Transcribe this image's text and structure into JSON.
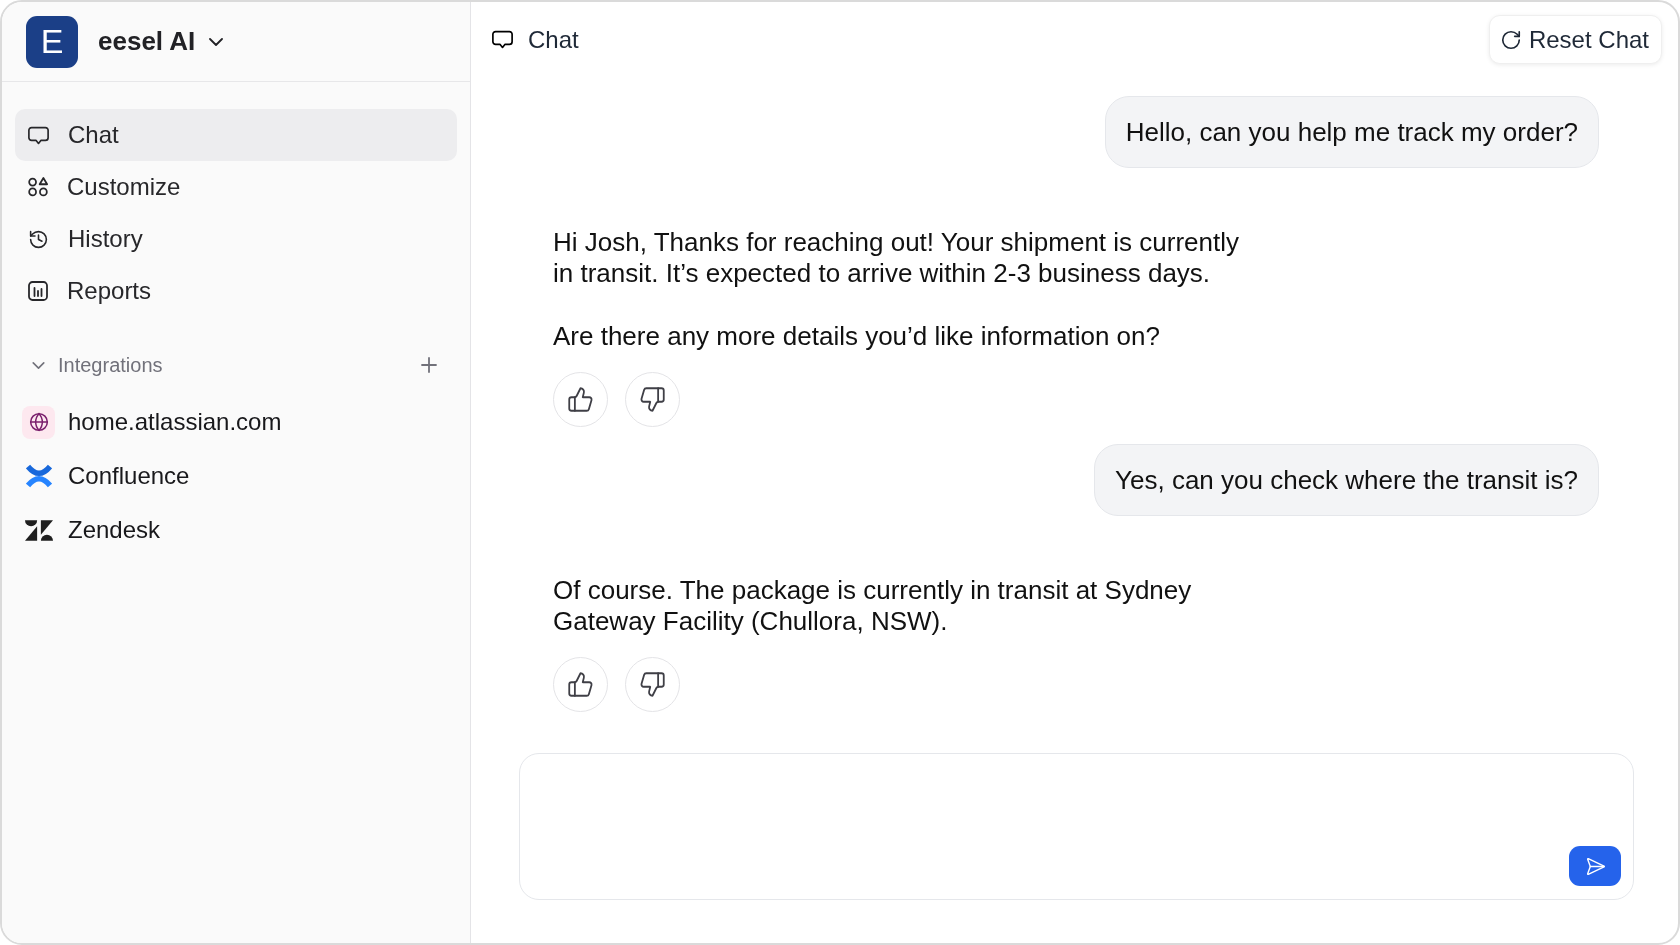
{
  "workspace": {
    "logo": "E",
    "name": "eesel AI"
  },
  "nav": [
    {
      "label": "Chat",
      "selected": true
    },
    {
      "label": "Customize",
      "selected": false
    },
    {
      "label": "History",
      "selected": false
    },
    {
      "label": "Reports",
      "selected": false
    }
  ],
  "integrations": {
    "title": "Integrations",
    "expanded": true,
    "items": [
      {
        "label": "home.atlassian.com"
      },
      {
        "label": "Confluence"
      },
      {
        "label": "Zendesk"
      }
    ]
  },
  "chat": {
    "title": "Chat",
    "reset_button": "Reset Chat",
    "messages": [
      {
        "kind": "user",
        "text": "Hello, can you help me track my order?"
      },
      {
        "kind": "bot",
        "paragraphs": [
          "Hi Josh, Thanks for reaching out! Your shipment is currently in transit. It’s expected to arrive within 2-3 business days.",
          "Are there any more details you’d like information on?"
        ]
      },
      {
        "kind": "user",
        "text": "Yes, can you check where the transit is?"
      },
      {
        "kind": "bot",
        "paragraphs": [
          "Of course. The package is currently in transit at Sydney Gateway Facility (Chullora, NSW)."
        ]
      }
    ]
  }
}
